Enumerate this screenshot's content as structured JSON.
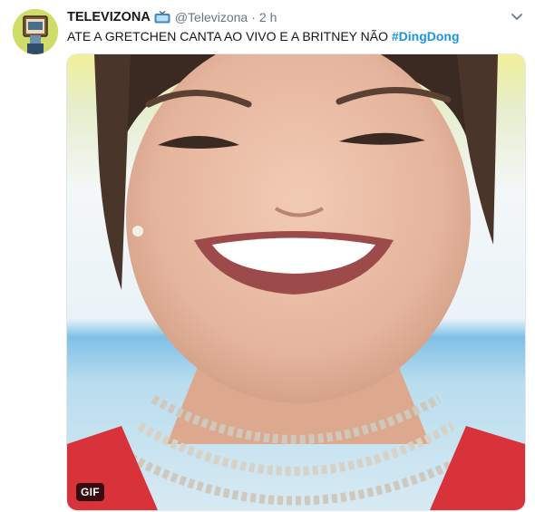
{
  "tweet": {
    "display_name": "TELEVIZONA",
    "handle": "@Televizona",
    "separator": "·",
    "time": "2 h",
    "text": "ATE A GRETCHEN CANTA AO VIVO E A BRITNEY NÃO ",
    "hashtag": "#DingDong",
    "media_badge": "GIF"
  },
  "icons": {
    "verified_like": "tv-emoji-icon",
    "menu": "chevron-down-icon"
  },
  "colors": {
    "link": "#1b95e0",
    "name": "#14171a",
    "secondary": "#657786"
  }
}
